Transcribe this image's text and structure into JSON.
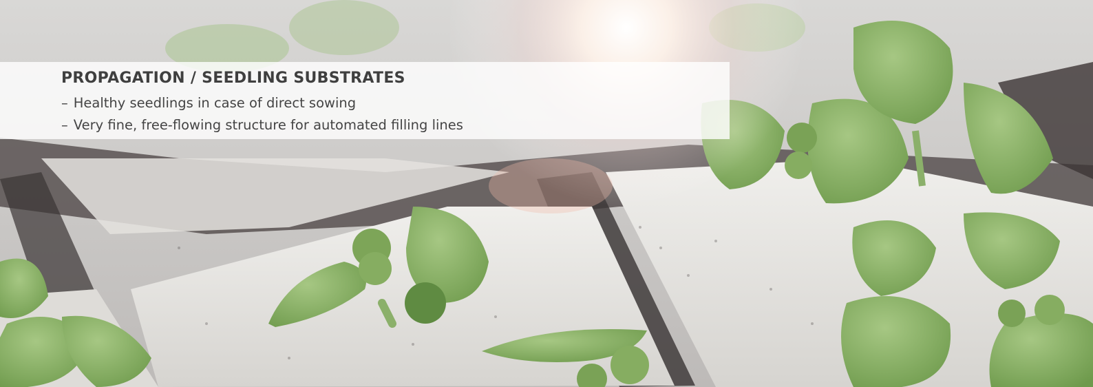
{
  "banner": {
    "title": "PROPAGATION / SEEDLING SUBSTRATES",
    "bullet_marker": "–",
    "bullets": [
      "Healthy seedlings in case of direct sowing",
      "Very fine, free-flowing structure for automated filling lines"
    ]
  },
  "photo": {
    "subject": "seedlings-in-substrate-blocks",
    "colors": {
      "substrate": "#e6e4df",
      "groove": "#3a3434",
      "leaf": "#8fb36a",
      "leaf_dark": "#5f8b42",
      "flare": "#ffffff"
    }
  }
}
